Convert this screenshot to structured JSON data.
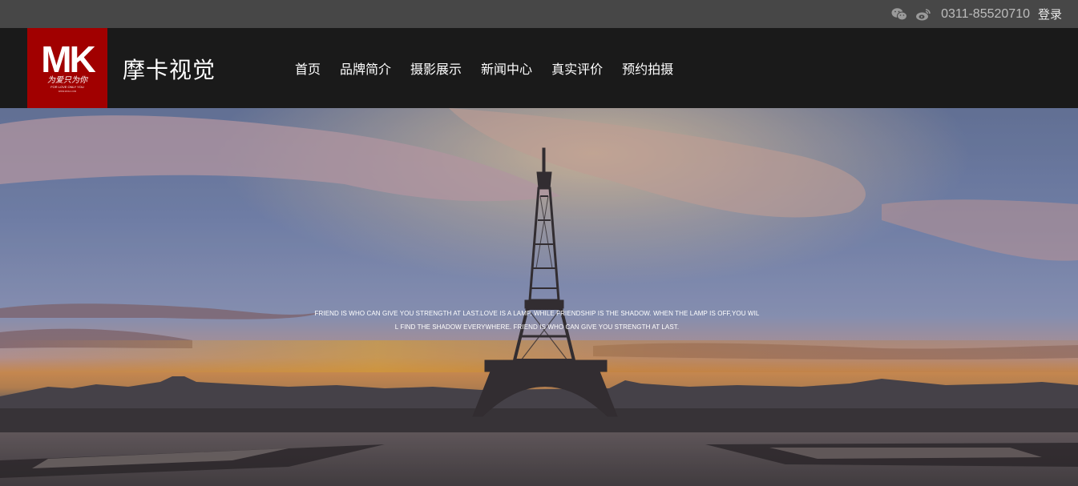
{
  "topbar": {
    "icons": [
      "wechat-icon",
      "weibo-icon"
    ],
    "phone": "0311-85520710",
    "login_label": "登录"
  },
  "header": {
    "logo": {
      "letters": "MK",
      "tagline_cn": "为爱只为你",
      "tagline_en": "FOR LOVE ONLY YOU",
      "url_small": "WWW.MOKA.COM",
      "bg_color": "#a10000"
    },
    "brand_name": "摩卡视觉",
    "nav": [
      "首页",
      "品牌简介",
      "摄影展示",
      "新闻中心",
      "真实评价",
      "预约拍摄"
    ]
  },
  "hero": {
    "caption_line1": "FRIEND IS WHO CAN GIVE YOU STRENGTH AT LAST.LOVE IS A LAMP, WHILE FRIENDSHIP IS THE SHADOW. WHEN THE LAMP IS OFF,YOU WIL",
    "caption_line2": "L FIND THE SHADOW EVERYWHERE. FRIEND IS WHO CAN GIVE YOU STRENGTH AT LAST."
  }
}
